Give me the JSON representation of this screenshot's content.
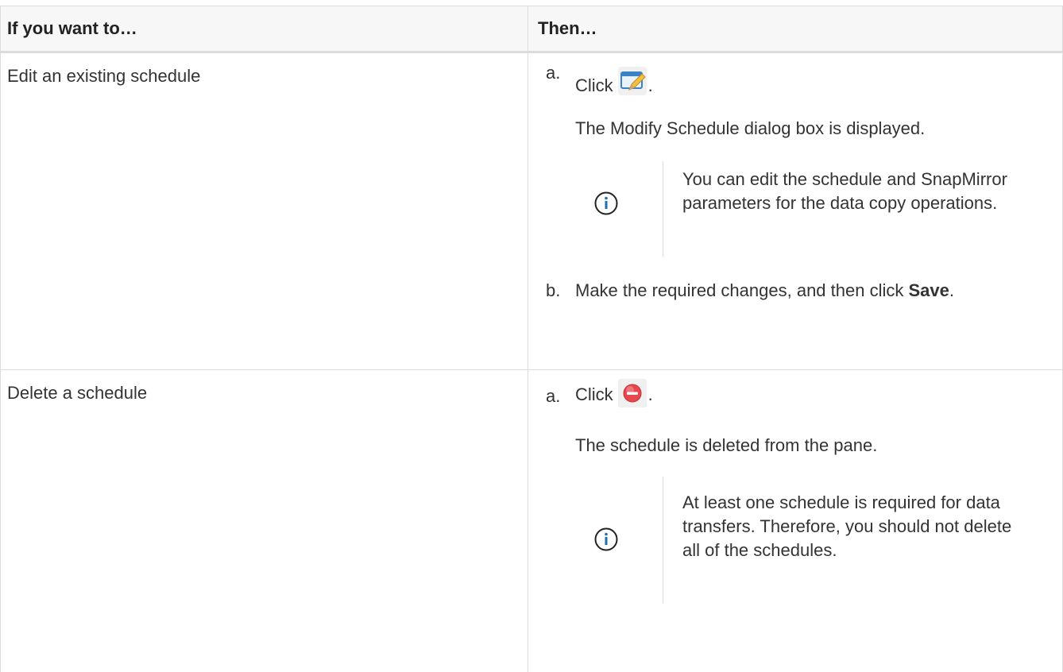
{
  "table": {
    "header": {
      "col1": "If you want to…",
      "col2": "Then…"
    },
    "rows": [
      {
        "action": "Edit an existing schedule",
        "step_a_marker": "a.",
        "step_a_text": "Click",
        "step_a_icon": "edit-schedule-icon",
        "step_a_period": ".",
        "result": "The Modify Schedule dialog box is displayed.",
        "note": "You can edit the schedule and SnapMirror parameters for the data copy operations.",
        "note_icon": "info-icon",
        "step_b_marker": "b.",
        "step_b_text_before": "Make the required changes, and then click",
        "step_b_bold": "Save",
        "step_b_period": "."
      },
      {
        "action": "Delete a schedule",
        "step_a_marker": "a.",
        "step_a_text": "Click",
        "step_a_icon": "delete-icon",
        "step_a_period": ".",
        "result": "The schedule is deleted from the pane.",
        "note": "At least one schedule is required for data transfers. Therefore, you should not delete all of the schedules.",
        "note_icon": "info-icon"
      }
    ]
  },
  "colors": {
    "info_blue": "#1a6fb5",
    "delete_red": "#e8474c",
    "border": "#dcdcdc",
    "header_bg": "#f7f7f7"
  }
}
